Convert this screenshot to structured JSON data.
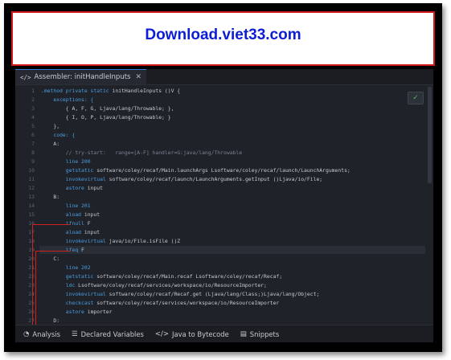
{
  "banner": {
    "text": "Download.viet33.com"
  },
  "tab": {
    "icon": "code-brackets-icon",
    "label": "Assembler: initHandleInputs",
    "close": "✕"
  },
  "editor": {
    "lines": [
      {
        "n": "1",
        "segs": [
          {
            "t": ".method private static ",
            "c": "kw"
          },
          {
            "t": "initHandleInputs ()V {",
            "c": "pl"
          }
        ]
      },
      {
        "n": "2",
        "segs": [
          {
            "t": "    exceptions: {",
            "c": "kw"
          }
        ]
      },
      {
        "n": "3",
        "segs": [
          {
            "t": "        { A, F, G, Ljava/lang/Throwable; },",
            "c": "pl"
          }
        ]
      },
      {
        "n": "4",
        "segs": [
          {
            "t": "        { I, O, P, Ljava/lang/Throwable; }",
            "c": "pl"
          }
        ]
      },
      {
        "n": "5",
        "segs": [
          {
            "t": "    },",
            "c": "pl"
          }
        ]
      },
      {
        "n": "6",
        "segs": [
          {
            "t": "    code: {",
            "c": "kw"
          }
        ]
      },
      {
        "n": "7",
        "segs": [
          {
            "t": "    A:",
            "c": "pl"
          }
        ]
      },
      {
        "n": "8",
        "segs": [
          {
            "t": "        // try-start:   range=[A-F] handler=G:java/lang/Throwable",
            "c": "cm"
          }
        ]
      },
      {
        "n": "9",
        "segs": [
          {
            "t": "        line 200",
            "c": "kw"
          }
        ]
      },
      {
        "n": "10",
        "segs": [
          {
            "t": "        getstatic ",
            "c": "kw"
          },
          {
            "t": "software/coley/recaf/Main.launchArgs Lsoftware/coley/recaf/launch/LaunchArguments;",
            "c": "pl"
          }
        ]
      },
      {
        "n": "11",
        "segs": [
          {
            "t": "        invokevirtual ",
            "c": "kw"
          },
          {
            "t": "software/coley/recaf/launch/LaunchArguments.getInput ()Ljava/io/File;",
            "c": "pl"
          }
        ]
      },
      {
        "n": "12",
        "segs": [
          {
            "t": "        astore ",
            "c": "kw"
          },
          {
            "t": "input",
            "c": "pl"
          }
        ]
      },
      {
        "n": "13",
        "segs": [
          {
            "t": "    B:",
            "c": "pl"
          }
        ]
      },
      {
        "n": "14",
        "segs": [
          {
            "t": "        line 201",
            "c": "kw"
          }
        ]
      },
      {
        "n": "15",
        "segs": [
          {
            "t": "        aload ",
            "c": "kw"
          },
          {
            "t": "input",
            "c": "pl"
          }
        ]
      },
      {
        "n": "16",
        "segs": [
          {
            "t": "        ifnull ",
            "c": "kw"
          },
          {
            "t": "F",
            "c": "pl"
          }
        ]
      },
      {
        "n": "17",
        "segs": [
          {
            "t": "        aload ",
            "c": "kw"
          },
          {
            "t": "input",
            "c": "pl"
          }
        ]
      },
      {
        "n": "18",
        "segs": [
          {
            "t": "        invokevirtual ",
            "c": "kw"
          },
          {
            "t": "java/io/File.isFile ()Z",
            "c": "pl"
          }
        ]
      },
      {
        "n": "19",
        "segs": [
          {
            "t": "        ifeq ",
            "c": "kw"
          },
          {
            "t": "F",
            "c": "pl"
          }
        ]
      },
      {
        "n": "20",
        "segs": [
          {
            "t": "    C:",
            "c": "pl"
          }
        ]
      },
      {
        "n": "21",
        "segs": [
          {
            "t": "        line 202",
            "c": "kw"
          }
        ]
      },
      {
        "n": "22",
        "segs": [
          {
            "t": "        getstatic ",
            "c": "kw"
          },
          {
            "t": "software/coley/recaf/Main.recaf Lsoftware/coley/recaf/Recaf;",
            "c": "pl"
          }
        ]
      },
      {
        "n": "23",
        "segs": [
          {
            "t": "        ldc ",
            "c": "kw"
          },
          {
            "t": "Lsoftware/coley/recaf/services/workspace/io/ResourceImporter;",
            "c": "pl"
          }
        ]
      },
      {
        "n": "24",
        "segs": [
          {
            "t": "        invokevirtual ",
            "c": "kw"
          },
          {
            "t": "software/coley/recaf/Recaf.get (Ljava/lang/Class;)Ljava/lang/Object;",
            "c": "pl"
          }
        ]
      },
      {
        "n": "25",
        "segs": [
          {
            "t": "        checkcast ",
            "c": "kw"
          },
          {
            "t": "software/coley/recaf/services/workspace/io/ResourceImporter",
            "c": "pl"
          }
        ]
      },
      {
        "n": "26",
        "segs": [
          {
            "t": "        astore ",
            "c": "kw"
          },
          {
            "t": "importer",
            "c": "pl"
          }
        ]
      },
      {
        "n": "27",
        "segs": [
          {
            "t": "    D:",
            "c": "pl"
          }
        ]
      }
    ],
    "check_icon": "checkmark-icon"
  },
  "bottom_tabs": [
    {
      "label": "Analysis",
      "icon": "analysis-icon",
      "glyph": "◔"
    },
    {
      "label": "Declared Variables",
      "icon": "list-icon",
      "glyph": "☰"
    },
    {
      "label": "Java to Bytecode",
      "icon": "code-brackets-icon",
      "glyph": "</>"
    },
    {
      "label": "Snippets",
      "icon": "snippets-icon",
      "glyph": "▤"
    }
  ]
}
